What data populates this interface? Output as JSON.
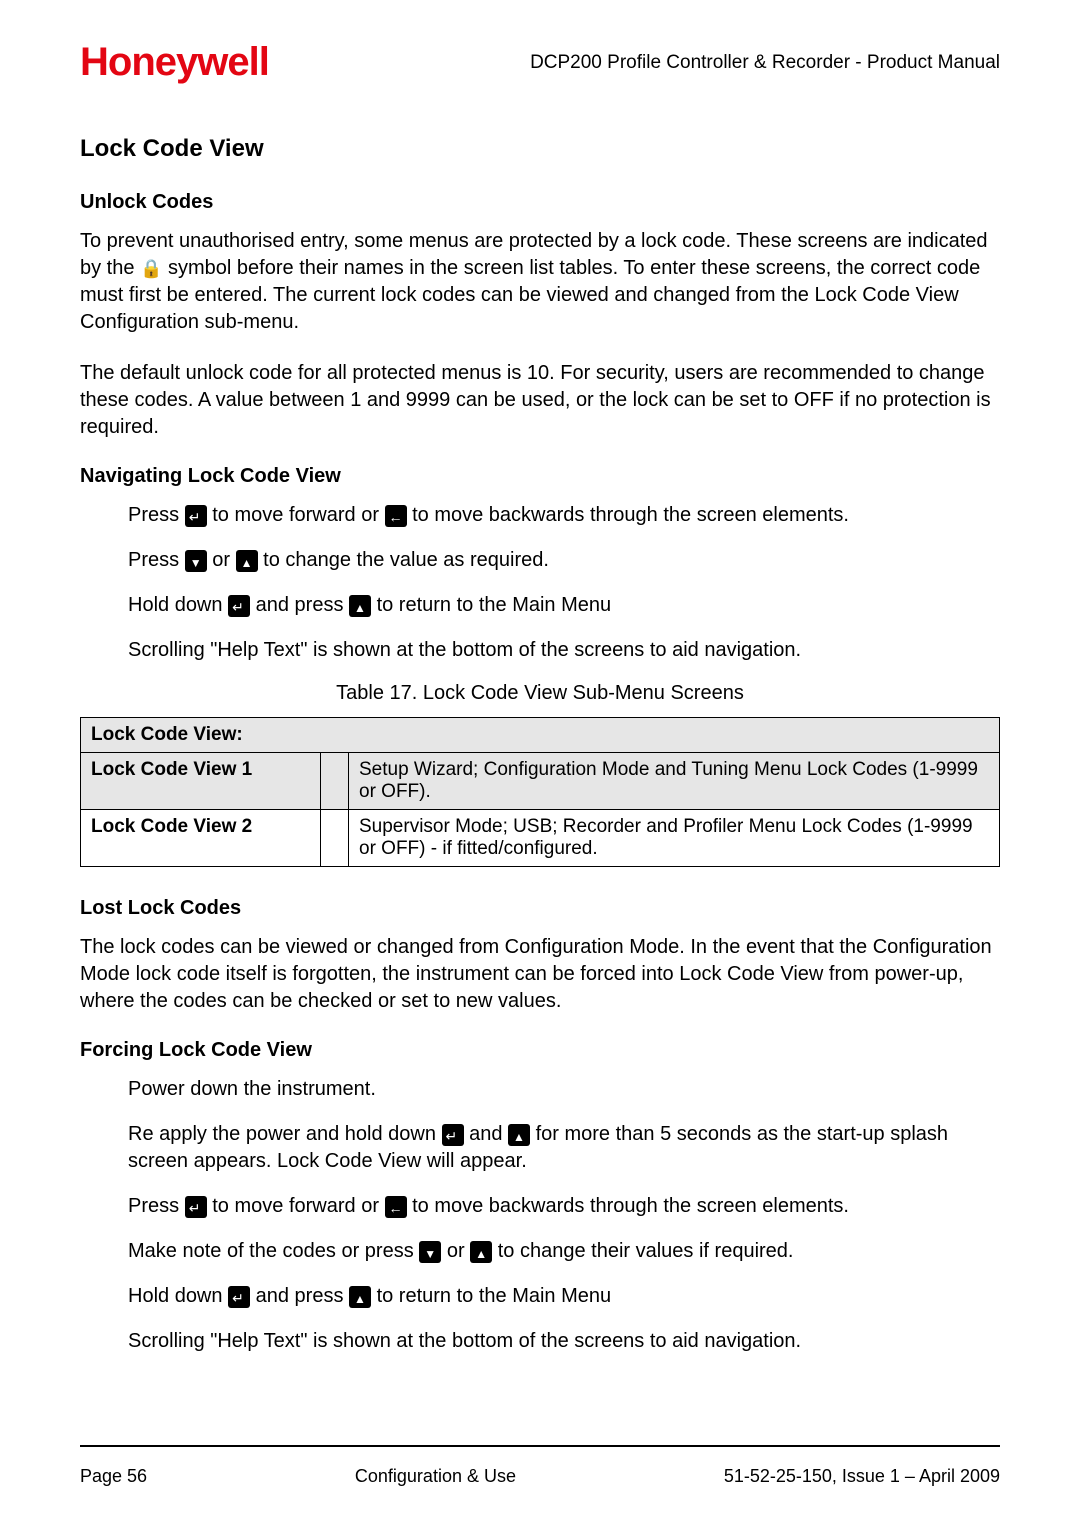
{
  "header": {
    "brand": "Honeywell",
    "doc_title": "DCP200 Profile Controller & Recorder - Product Manual"
  },
  "section_title": "Lock Code View",
  "unlock": {
    "heading": "Unlock Codes",
    "p1a": "To prevent unauthorised entry, some menus are protected by a lock code. These screens are indicated by the ",
    "p1b": " symbol before their names in the screen list tables. To enter these screens, the correct code must first be entered. The current lock codes can be viewed and changed from the Lock Code View Configuration sub-menu.",
    "p2": "The default unlock code for all protected menus is 10. For security, users are recommended to change these codes. A value between 1 and 9999 can be used, or the lock can be set to OFF if no protection is required."
  },
  "navigating": {
    "heading": "Navigating Lock Code View",
    "l1a": "Press ",
    "l1b": " to move forward or ",
    "l1c": " to move backwards through the screen elements.",
    "l2a": "Press ",
    "l2b": " or ",
    "l2c": " to change the value as required.",
    "l3a": "Hold down ",
    "l3b": " and press ",
    "l3c": " to return to the Main Menu",
    "l4": "Scrolling \"Help Text\" is shown at the bottom of the screens to aid navigation."
  },
  "table": {
    "caption": "Table 17.  Lock Code View Sub-Menu Screens",
    "header": "Lock Code View:",
    "rows": [
      {
        "name": "Lock Code View 1",
        "desc": "Setup Wizard; Configuration Mode and Tuning Menu Lock Codes (1-9999 or OFF)."
      },
      {
        "name": "Lock Code View 2",
        "desc": "Supervisor Mode; USB; Recorder and Profiler Menu Lock Codes (1-9999 or OFF) - if fitted/configured."
      }
    ]
  },
  "lost": {
    "heading": "Lost Lock Codes",
    "p1": "The lock codes can be viewed or changed from Configuration Mode. In the event that the Configuration Mode lock code itself is forgotten, the instrument can be forced into Lock Code View from power-up, where the codes can be checked or set to new values."
  },
  "forcing": {
    "heading": "Forcing Lock Code View",
    "l1": "Power down the instrument.",
    "l2a": "Re apply the power and hold down ",
    "l2b": " and ",
    "l2c": " for more than 5 seconds as the start-up splash screen appears. Lock Code View will appear.",
    "l3a": "Press ",
    "l3b": " to move forward or ",
    "l3c": " to move backwards through the screen elements.",
    "l4a": "Make note of the codes or press ",
    "l4b": " or ",
    "l4c": " to change their values if required.",
    "l5a": "Hold down ",
    "l5b": " and press ",
    "l5c": " to return to the Main Menu",
    "l6": "Scrolling \"Help Text\" is shown at the bottom of the screens to aid navigation."
  },
  "footer": {
    "left": "Page 56",
    "center": "Configuration & Use",
    "right": "51-52-25-150, Issue 1 – April 2009"
  }
}
